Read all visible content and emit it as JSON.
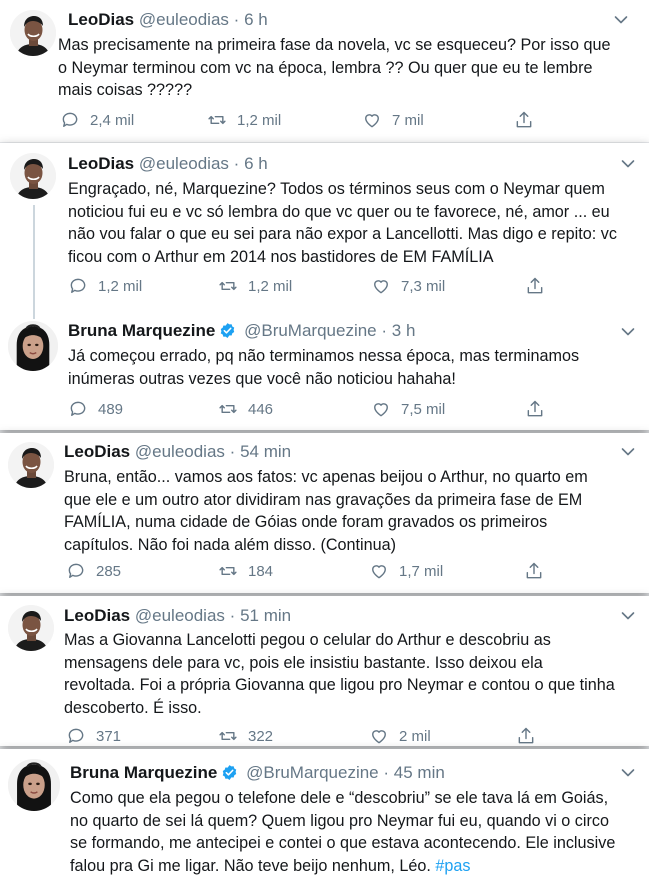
{
  "tweets": [
    {
      "name": "LeoDias",
      "handle": "@euleodias",
      "time": "6 h",
      "verified": false,
      "lines": [
        "Mas precisamente na primeira fase da novela, vc se esqueceu? Por isso que",
        "o Neymar terminou com vc na época, lembra ?? Ou quer que eu te lembre",
        "mais coisas ?????"
      ],
      "replies": "2,4 mil",
      "retweets": "1,2 mil",
      "likes": "7 mil"
    },
    {
      "name": "LeoDias",
      "handle": "@euleodias",
      "time": "6 h",
      "verified": false,
      "lines": [
        "Engraçado, né, Marquezine? Todos os términos seus com o Neymar quem",
        "noticiou fui eu e vc só lembra do que vc quer ou te favorece, né, amor ... eu",
        "não vou falar o que eu sei para não expor a Lancellotti. Mas digo e repito: vc",
        "ficou com o Arthur em 2014 nos bastidores de EM FAMÍLIA"
      ],
      "replies": "1,2 mil",
      "retweets": "1,2 mil",
      "likes": "7,3 mil"
    },
    {
      "name": "Bruna Marquezine",
      "handle": "@BruMarquezine",
      "time": "3 h",
      "verified": true,
      "lines": [
        "Já começou errado, pq não terminamos nessa época, mas terminamos",
        "inúmeras outras vezes que você não noticiou hahaha!"
      ],
      "replies": "489",
      "retweets": "446",
      "likes": "7,5 mil"
    },
    {
      "name": "LeoDias",
      "handle": "@euleodias",
      "time": "54 min",
      "verified": false,
      "lines": [
        "Bruna, então... vamos aos fatos: vc apenas beijou o Arthur, no quarto em",
        "que ele e um outro ator dividiram nas gravações da primeira fase de EM",
        "FAMÍLIA, numa cidade de Góias onde foram gravados os primeiros",
        "capítulos. Não foi nada além disso. (Continua)"
      ],
      "replies": "285",
      "retweets": "184",
      "likes": "1,7 mil"
    },
    {
      "name": "LeoDias",
      "handle": "@euleodias",
      "time": "51 min",
      "verified": false,
      "lines": [
        "Mas a Giovanna Lancelotti pegou o celular do Arthur e descobriu as",
        "mensagens dele para vc, pois ele insistiu bastante. Isso deixou ela",
        "revoltada. Foi a própria Giovanna que ligou pro Neymar e contou o que tinha",
        "descoberto. É isso."
      ],
      "replies": "371",
      "retweets": "322",
      "likes": "2 mil"
    },
    {
      "name": "Bruna Marquezine",
      "handle": "@BruMarquezine",
      "time": "45 min",
      "verified": true,
      "lines": [
        "Como que ela pegou o telefone dele e “descobriu” se ele tava lá em Goiás,",
        "no quarto de sei lá quem? Quem ligou pro Neymar fui eu, quando vi o circo",
        "se formando, me antecipei e contei o que estava acontecendo. Ele inclusive",
        "falou pra Gi me ligar. Não teve beijo nenhum, Léo."
      ],
      "hashtag": "#pas"
    }
  ],
  "colors": {
    "verified": "#1da1f2",
    "hashtag": "#1da1f2",
    "muted": "#657786"
  }
}
